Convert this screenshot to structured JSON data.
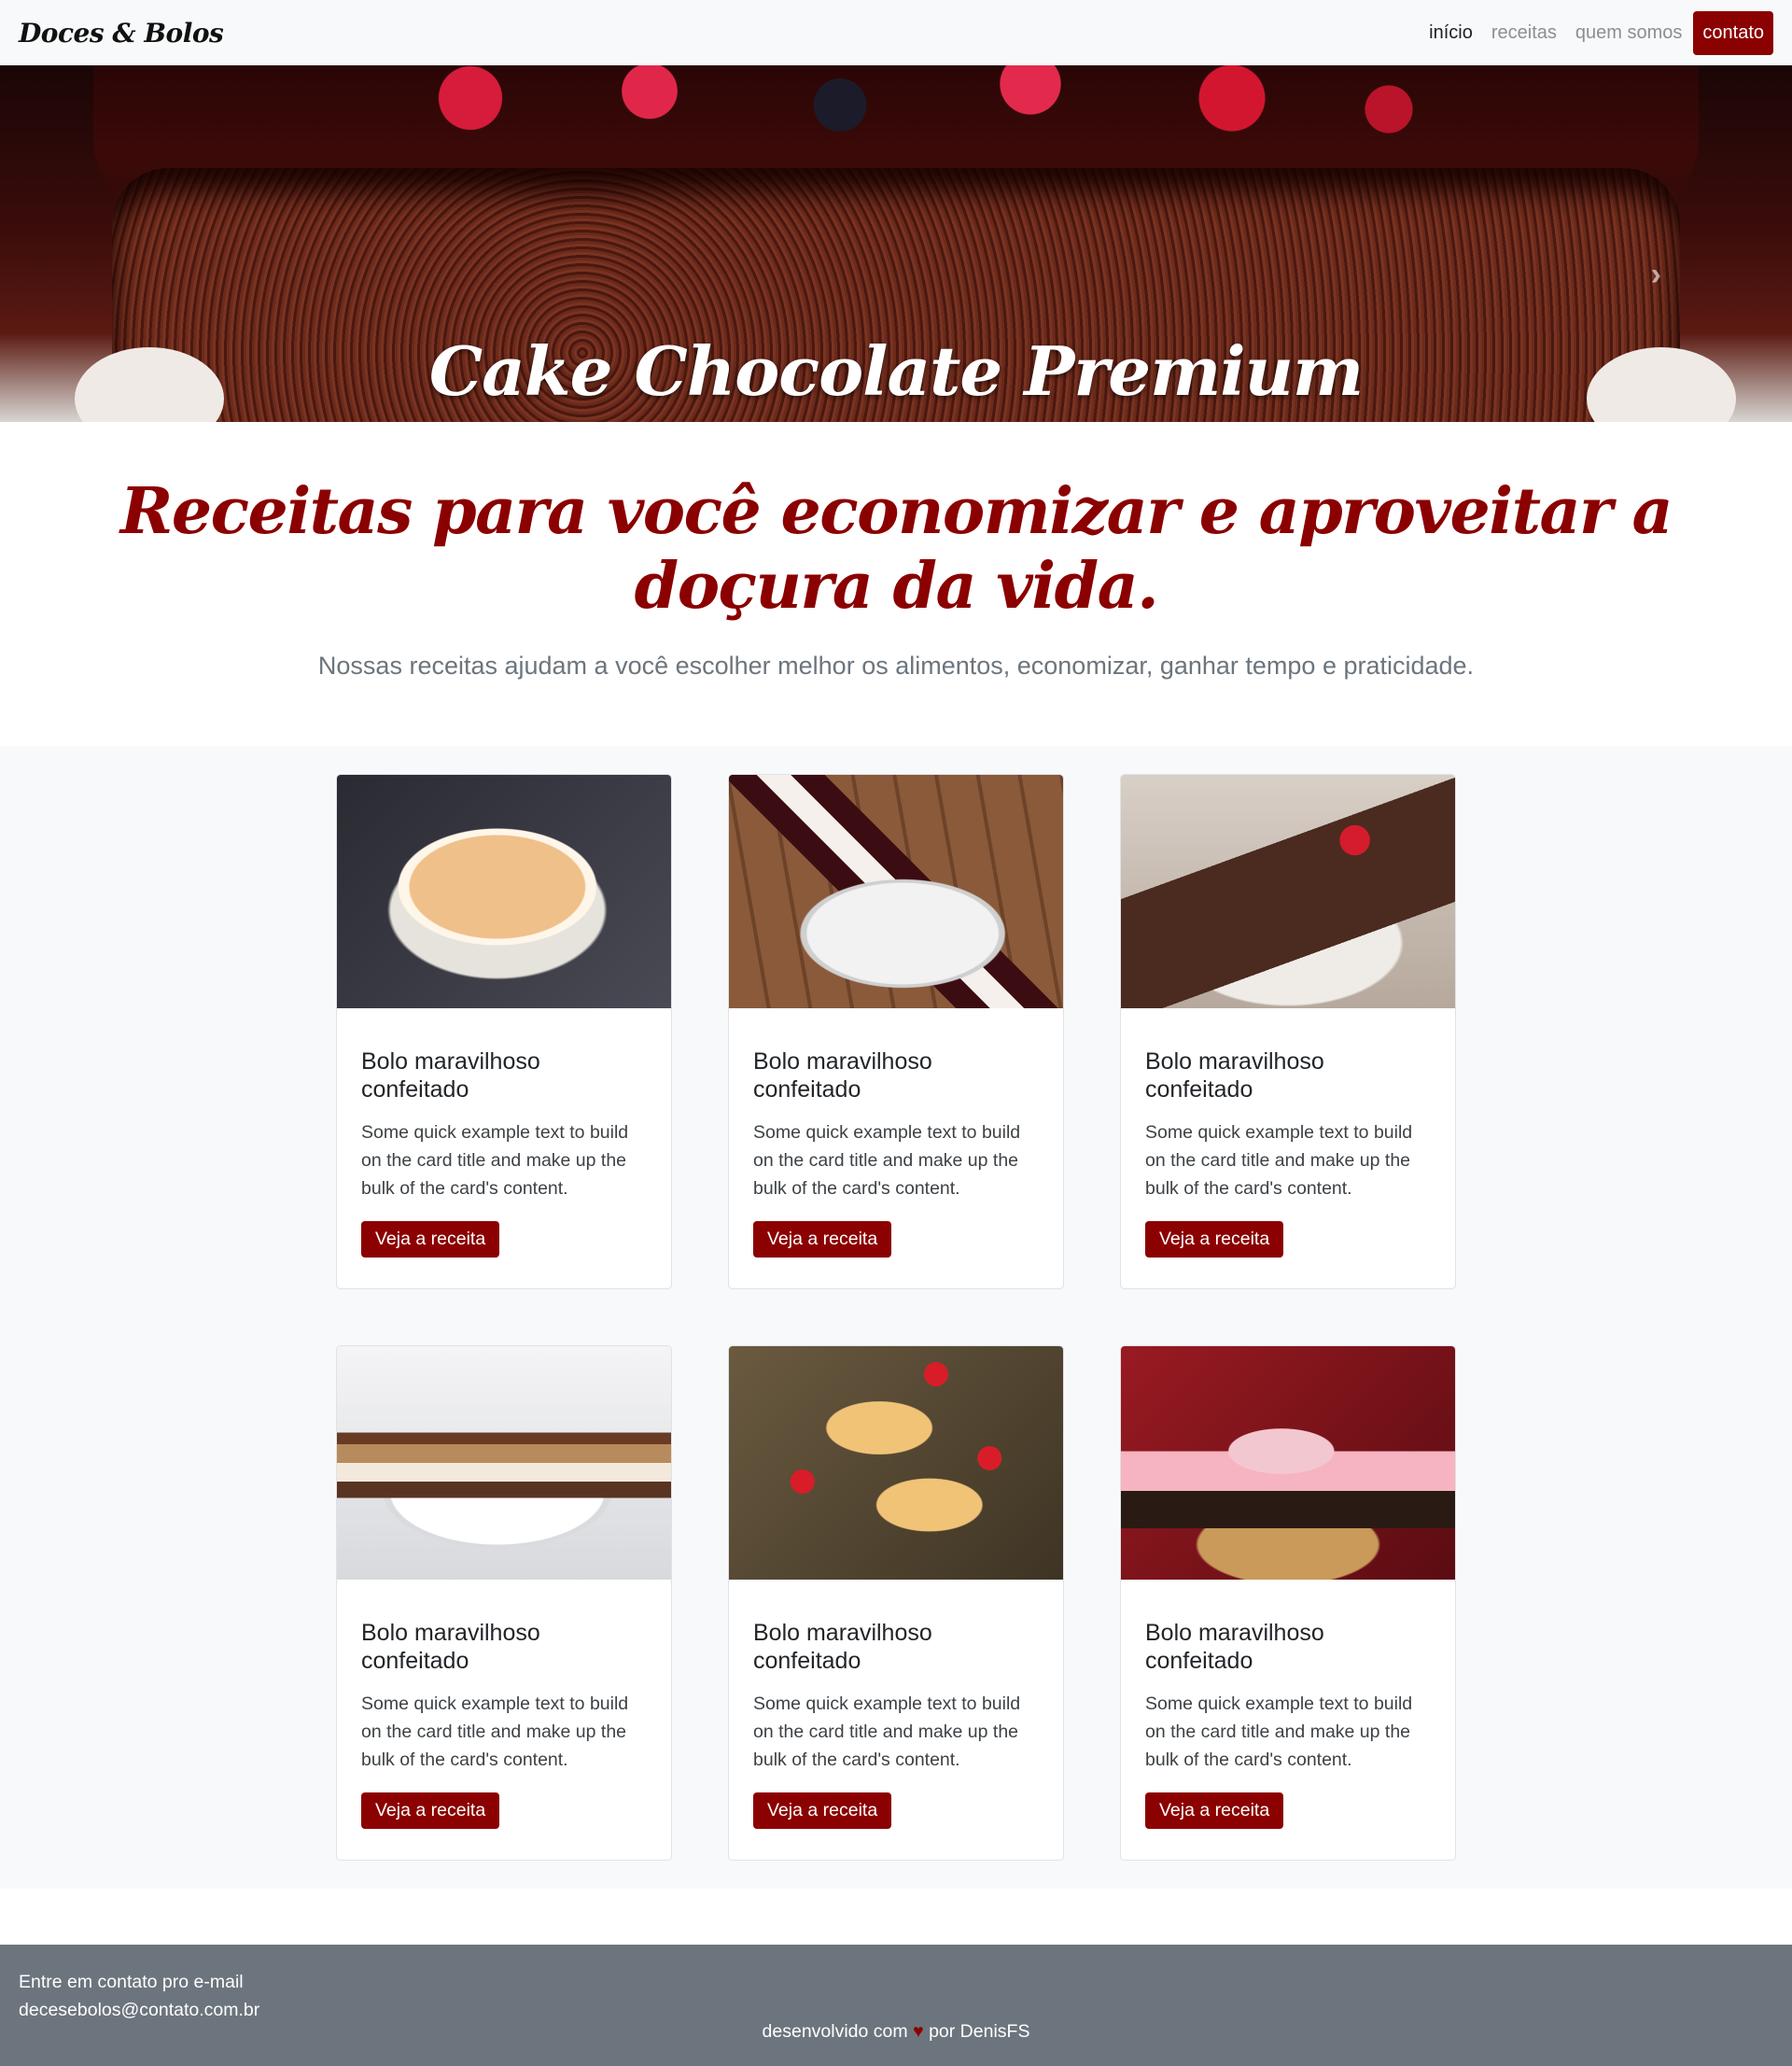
{
  "navbar": {
    "brand": "Doces & Bolos",
    "links": [
      {
        "label": "início"
      },
      {
        "label": "receitas"
      },
      {
        "label": "quem somos"
      },
      {
        "label": "contato"
      }
    ]
  },
  "hero": {
    "caption": "Cake Chocolate Premium",
    "next_icon": "chevron-right-icon",
    "slides": 2,
    "active_slide": 1
  },
  "intro": {
    "headline": "Receitas para você economizar e aproveitar a doçura da vida.",
    "subheadline": "Nossas receitas ajudam a você escolher melhor os alimentos, economizar, ganhar tempo e praticidade."
  },
  "cards": [
    {
      "title": "Bolo maravilhoso confeitado",
      "text": "Some quick example text to build on the card title and make up the bulk of the card's content.",
      "button": "Veja a receita"
    },
    {
      "title": "Bolo maravilhoso confeitado",
      "text": "Some quick example text to build on the card title and make up the bulk of the card's content.",
      "button": "Veja a receita"
    },
    {
      "title": "Bolo maravilhoso confeitado",
      "text": "Some quick example text to build on the card title and make up the bulk of the card's content.",
      "button": "Veja a receita"
    },
    {
      "title": "Bolo maravilhoso confeitado",
      "text": "Some quick example text to build on the card title and make up the bulk of the card's content.",
      "button": "Veja a receita"
    },
    {
      "title": "Bolo maravilhoso confeitado",
      "text": "Some quick example text to build on the card title and make up the bulk of the card's content.",
      "button": "Veja a receita"
    },
    {
      "title": "Bolo maravilhoso confeitado",
      "text": "Some quick example text to build on the card title and make up the bulk of the card's content.",
      "button": "Veja a receita"
    }
  ],
  "footer": {
    "contact_label": "Entre em contato pro e-mail",
    "email": "decesebolos@contato.com.br",
    "credits_prefix": "desenvolvido com",
    "heart": "♥",
    "credits_by": "por",
    "author": "DenisFS"
  },
  "colors": {
    "accent": "#8b0000",
    "navbar_bg": "#f8f9fa",
    "footer_bg": "#6c757d",
    "muted_text": "#6c757d"
  }
}
